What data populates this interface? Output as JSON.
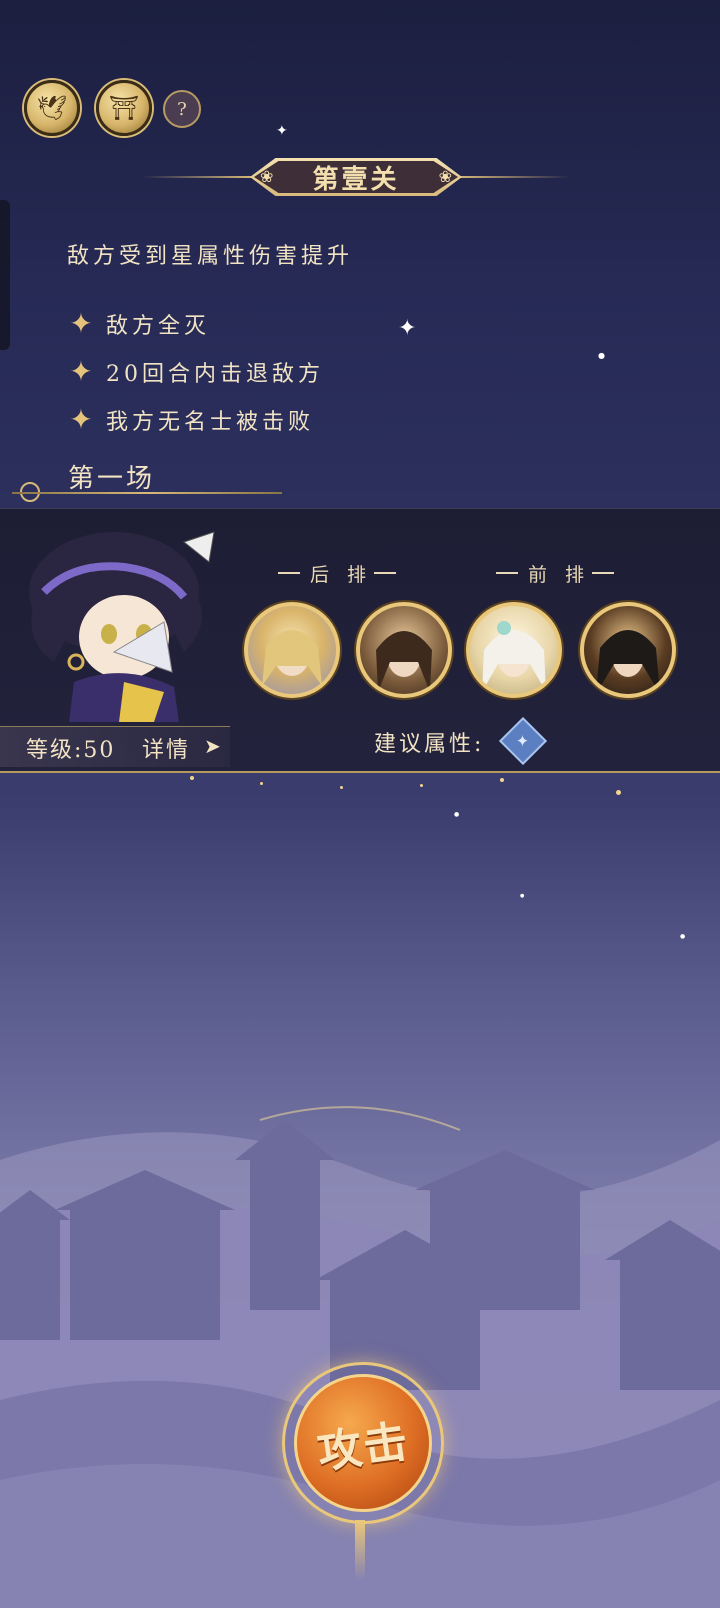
{
  "top_buttons": [
    {
      "icon": "bird-emblem-icon"
    },
    {
      "icon": "pavilion-icon"
    },
    {
      "icon": "help-icon",
      "label": "?"
    }
  ],
  "stage": {
    "title": "第壹关",
    "description": "敌方受到星属性伤害提升"
  },
  "objectives": [
    {
      "text": "敌方全灭"
    },
    {
      "text": "20回合内击退敌方"
    },
    {
      "text": "我方无名士被击败"
    }
  ],
  "round_label": "第一场",
  "enemy": {
    "level_text": "等级:50",
    "detail_label": "详情",
    "back_row_label": "后 排",
    "front_row_label": "前 排",
    "suggest_label": "建议属性:",
    "suggest_icon": "star-attribute-icon",
    "portraits": [
      {
        "icon": "blonde-character-portrait"
      },
      {
        "icon": "brown-hair-character-portrait"
      },
      {
        "icon": "white-hair-character-portrait"
      },
      {
        "icon": "black-hair-character-portrait"
      }
    ]
  },
  "attack_button": {
    "label": "攻击"
  },
  "colors": {
    "gold": "#e9c77b",
    "cream_text": "#f1e3c3",
    "attack_orange": "#de6e24",
    "panel_dark": "#22213a"
  }
}
